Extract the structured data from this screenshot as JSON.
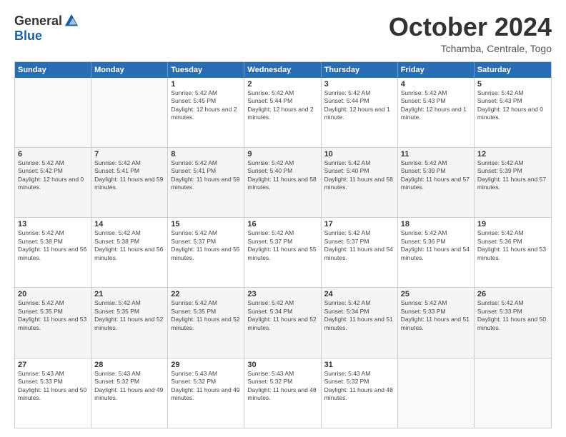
{
  "logo": {
    "general": "General",
    "blue": "Blue"
  },
  "title": "October 2024",
  "location": "Tchamba, Centrale, Togo",
  "days_of_week": [
    "Sunday",
    "Monday",
    "Tuesday",
    "Wednesday",
    "Thursday",
    "Friday",
    "Saturday"
  ],
  "weeks": [
    [
      {
        "day": "",
        "sunrise": "",
        "sunset": "",
        "daylight": ""
      },
      {
        "day": "",
        "sunrise": "",
        "sunset": "",
        "daylight": ""
      },
      {
        "day": "1",
        "sunrise": "Sunrise: 5:42 AM",
        "sunset": "Sunset: 5:45 PM",
        "daylight": "Daylight: 12 hours and 2 minutes."
      },
      {
        "day": "2",
        "sunrise": "Sunrise: 5:42 AM",
        "sunset": "Sunset: 5:44 PM",
        "daylight": "Daylight: 12 hours and 2 minutes."
      },
      {
        "day": "3",
        "sunrise": "Sunrise: 5:42 AM",
        "sunset": "Sunset: 5:44 PM",
        "daylight": "Daylight: 12 hours and 1 minute."
      },
      {
        "day": "4",
        "sunrise": "Sunrise: 5:42 AM",
        "sunset": "Sunset: 5:43 PM",
        "daylight": "Daylight: 12 hours and 1 minute."
      },
      {
        "day": "5",
        "sunrise": "Sunrise: 5:42 AM",
        "sunset": "Sunset: 5:43 PM",
        "daylight": "Daylight: 12 hours and 0 minutes."
      }
    ],
    [
      {
        "day": "6",
        "sunrise": "Sunrise: 5:42 AM",
        "sunset": "Sunset: 5:42 PM",
        "daylight": "Daylight: 12 hours and 0 minutes."
      },
      {
        "day": "7",
        "sunrise": "Sunrise: 5:42 AM",
        "sunset": "Sunset: 5:41 PM",
        "daylight": "Daylight: 11 hours and 59 minutes."
      },
      {
        "day": "8",
        "sunrise": "Sunrise: 5:42 AM",
        "sunset": "Sunset: 5:41 PM",
        "daylight": "Daylight: 11 hours and 59 minutes."
      },
      {
        "day": "9",
        "sunrise": "Sunrise: 5:42 AM",
        "sunset": "Sunset: 5:40 PM",
        "daylight": "Daylight: 11 hours and 58 minutes."
      },
      {
        "day": "10",
        "sunrise": "Sunrise: 5:42 AM",
        "sunset": "Sunset: 5:40 PM",
        "daylight": "Daylight: 11 hours and 58 minutes."
      },
      {
        "day": "11",
        "sunrise": "Sunrise: 5:42 AM",
        "sunset": "Sunset: 5:39 PM",
        "daylight": "Daylight: 11 hours and 57 minutes."
      },
      {
        "day": "12",
        "sunrise": "Sunrise: 5:42 AM",
        "sunset": "Sunset: 5:39 PM",
        "daylight": "Daylight: 11 hours and 57 minutes."
      }
    ],
    [
      {
        "day": "13",
        "sunrise": "Sunrise: 5:42 AM",
        "sunset": "Sunset: 5:38 PM",
        "daylight": "Daylight: 11 hours and 56 minutes."
      },
      {
        "day": "14",
        "sunrise": "Sunrise: 5:42 AM",
        "sunset": "Sunset: 5:38 PM",
        "daylight": "Daylight: 11 hours and 56 minutes."
      },
      {
        "day": "15",
        "sunrise": "Sunrise: 5:42 AM",
        "sunset": "Sunset: 5:37 PM",
        "daylight": "Daylight: 11 hours and 55 minutes."
      },
      {
        "day": "16",
        "sunrise": "Sunrise: 5:42 AM",
        "sunset": "Sunset: 5:37 PM",
        "daylight": "Daylight: 11 hours and 55 minutes."
      },
      {
        "day": "17",
        "sunrise": "Sunrise: 5:42 AM",
        "sunset": "Sunset: 5:37 PM",
        "daylight": "Daylight: 11 hours and 54 minutes."
      },
      {
        "day": "18",
        "sunrise": "Sunrise: 5:42 AM",
        "sunset": "Sunset: 5:36 PM",
        "daylight": "Daylight: 11 hours and 54 minutes."
      },
      {
        "day": "19",
        "sunrise": "Sunrise: 5:42 AM",
        "sunset": "Sunset: 5:36 PM",
        "daylight": "Daylight: 11 hours and 53 minutes."
      }
    ],
    [
      {
        "day": "20",
        "sunrise": "Sunrise: 5:42 AM",
        "sunset": "Sunset: 5:35 PM",
        "daylight": "Daylight: 11 hours and 53 minutes."
      },
      {
        "day": "21",
        "sunrise": "Sunrise: 5:42 AM",
        "sunset": "Sunset: 5:35 PM",
        "daylight": "Daylight: 11 hours and 52 minutes."
      },
      {
        "day": "22",
        "sunrise": "Sunrise: 5:42 AM",
        "sunset": "Sunset: 5:35 PM",
        "daylight": "Daylight: 11 hours and 52 minutes."
      },
      {
        "day": "23",
        "sunrise": "Sunrise: 5:42 AM",
        "sunset": "Sunset: 5:34 PM",
        "daylight": "Daylight: 11 hours and 52 minutes."
      },
      {
        "day": "24",
        "sunrise": "Sunrise: 5:42 AM",
        "sunset": "Sunset: 5:34 PM",
        "daylight": "Daylight: 11 hours and 51 minutes."
      },
      {
        "day": "25",
        "sunrise": "Sunrise: 5:42 AM",
        "sunset": "Sunset: 5:33 PM",
        "daylight": "Daylight: 11 hours and 51 minutes."
      },
      {
        "day": "26",
        "sunrise": "Sunrise: 5:42 AM",
        "sunset": "Sunset: 5:33 PM",
        "daylight": "Daylight: 11 hours and 50 minutes."
      }
    ],
    [
      {
        "day": "27",
        "sunrise": "Sunrise: 5:43 AM",
        "sunset": "Sunset: 5:33 PM",
        "daylight": "Daylight: 11 hours and 50 minutes."
      },
      {
        "day": "28",
        "sunrise": "Sunrise: 5:43 AM",
        "sunset": "Sunset: 5:32 PM",
        "daylight": "Daylight: 11 hours and 49 minutes."
      },
      {
        "day": "29",
        "sunrise": "Sunrise: 5:43 AM",
        "sunset": "Sunset: 5:32 PM",
        "daylight": "Daylight: 11 hours and 49 minutes."
      },
      {
        "day": "30",
        "sunrise": "Sunrise: 5:43 AM",
        "sunset": "Sunset: 5:32 PM",
        "daylight": "Daylight: 11 hours and 48 minutes."
      },
      {
        "day": "31",
        "sunrise": "Sunrise: 5:43 AM",
        "sunset": "Sunset: 5:32 PM",
        "daylight": "Daylight: 11 hours and 48 minutes."
      },
      {
        "day": "",
        "sunrise": "",
        "sunset": "",
        "daylight": ""
      },
      {
        "day": "",
        "sunrise": "",
        "sunset": "",
        "daylight": ""
      }
    ]
  ]
}
